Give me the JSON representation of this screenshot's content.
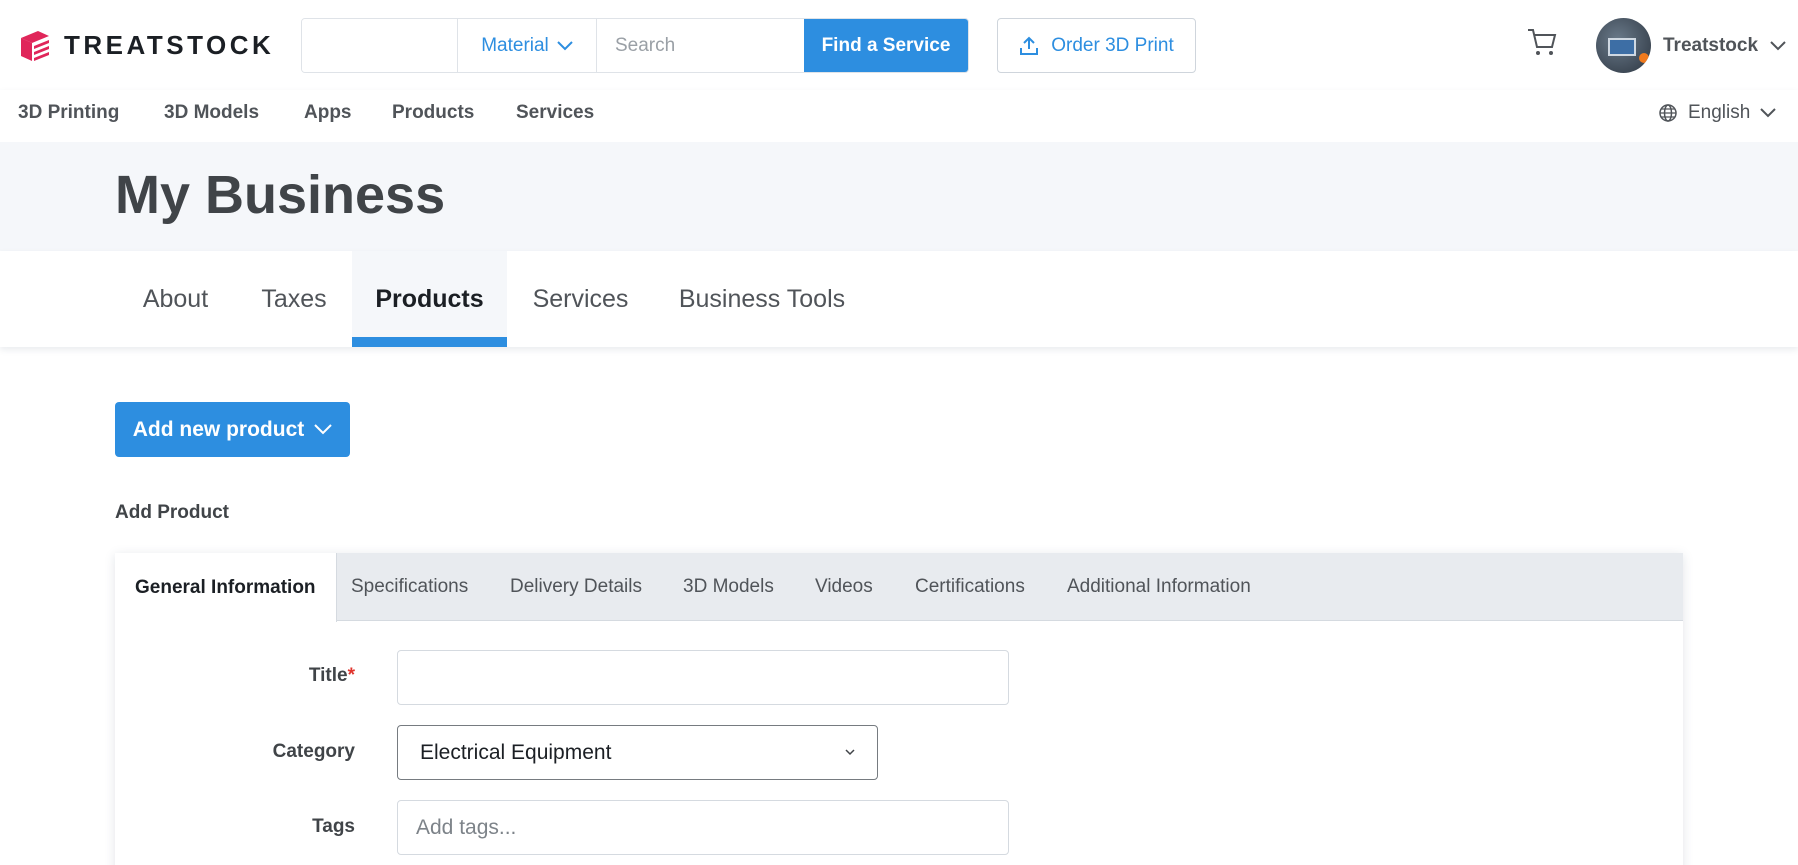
{
  "brand": {
    "name": "TREATSTOCK",
    "accent": "#2d8ee0",
    "logo_color": "#e0265a"
  },
  "header": {
    "material_label": "Material",
    "search_placeholder": "Search",
    "find_service_label": "Find a Service",
    "order_label": "Order 3D Print",
    "user_name": "Treatstock"
  },
  "nav": {
    "items": [
      "3D Printing",
      "3D Models",
      "Apps",
      "Products",
      "Services"
    ],
    "language": "English"
  },
  "page": {
    "title": "My Business"
  },
  "biz_tabs": [
    "About",
    "Taxes",
    "Products",
    "Services",
    "Business Tools"
  ],
  "biz_tab_active": "Products",
  "add_button_label": "Add new product",
  "section_label": "Add Product",
  "card_tabs": [
    "General Information",
    "Specifications",
    "Delivery Details",
    "3D Models",
    "Videos",
    "Certifications",
    "Additional Information"
  ],
  "card_tab_active": "General Information",
  "form": {
    "title_label": "Title",
    "title_required_mark": "*",
    "title_value": "",
    "category_label": "Category",
    "category_value": "Electrical Equipment",
    "tags_label": "Tags",
    "tags_placeholder": "Add tags..."
  }
}
